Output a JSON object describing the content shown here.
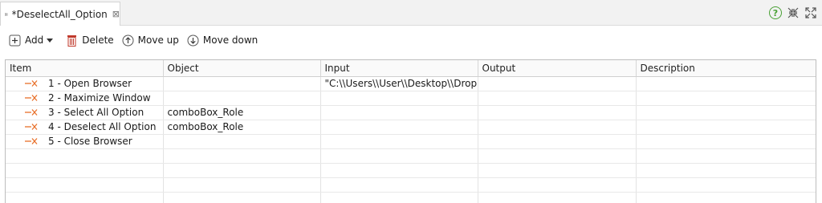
{
  "tab": {
    "title": "*DeselectAll_Option",
    "close_glyph": "⊠",
    "help_glyph": "?"
  },
  "toolbar": {
    "add_label": "Add",
    "delete_label": "Delete",
    "move_up_label": "Move up",
    "move_down_label": "Move down"
  },
  "table": {
    "columns": [
      "Item",
      "Object",
      "Input",
      "Output",
      "Description"
    ],
    "rows": [
      {
        "item": "1 - Open Browser",
        "object": "",
        "input": "\"C:\\\\Users\\\\User\\\\Desktop\\\\DropDow",
        "output": "",
        "description": ""
      },
      {
        "item": "2 - Maximize Window",
        "object": "",
        "input": "",
        "output": "",
        "description": ""
      },
      {
        "item": "3 - Select All Option",
        "object": "comboBox_Role",
        "input": "",
        "output": "",
        "description": ""
      },
      {
        "item": "4 - Deselect All Option",
        "object": "comboBox_Role",
        "input": "",
        "output": "",
        "description": ""
      },
      {
        "item": "5 - Close Browser",
        "object": "",
        "input": "",
        "output": "",
        "description": ""
      }
    ]
  },
  "colors": {
    "step_icon": "#e8702a",
    "help_green": "#49a035",
    "delete_red": "#c0392b"
  }
}
